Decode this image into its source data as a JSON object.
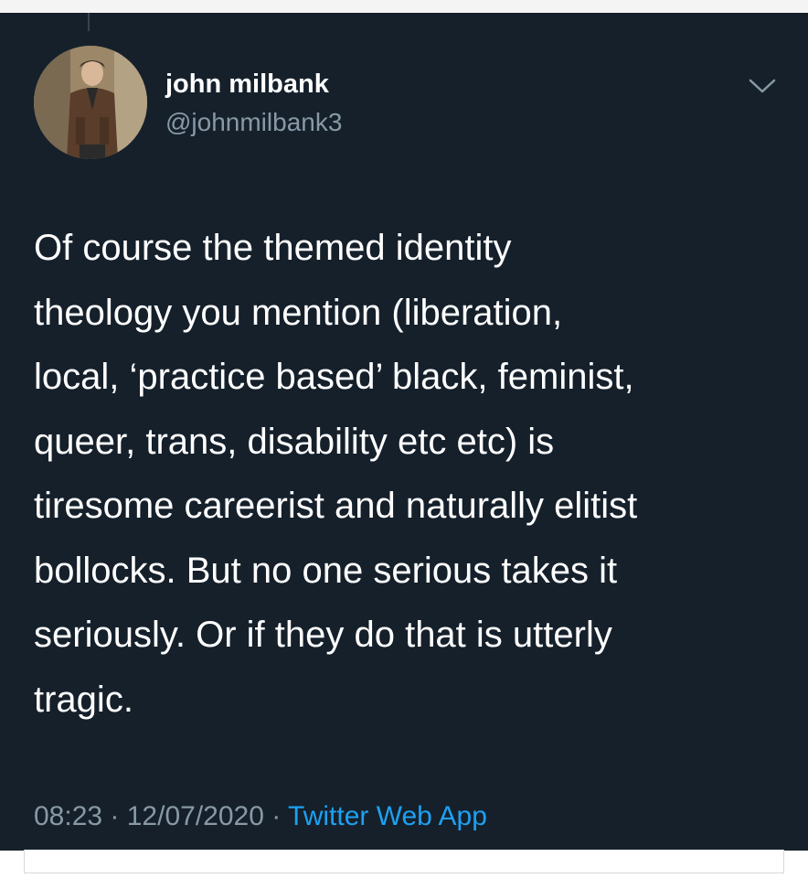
{
  "tweet": {
    "author": {
      "name": "john milbank",
      "handle": "@johnmilbank3"
    },
    "text_lines": [
      "Of course the themed identity",
      "theology you mention (liberation,",
      "local, ‘practice based’ black, feminist,",
      "queer, trans, disability etc etc) is",
      "tiresome careerist and naturally elitist",
      "bollocks. But no one serious takes it",
      "seriously. Or if they do that is utterly",
      "tragic."
    ],
    "time": "08:23",
    "date": "12/07/2020",
    "separator": " · ",
    "source": "Twitter Web App"
  },
  "icons": {
    "menu": "chevron-down-icon",
    "avatar": "avatar-photo"
  },
  "colors": {
    "background": "#15202b",
    "text": "#ffffff",
    "secondary": "#8899a6",
    "link": "#1da1f2"
  }
}
